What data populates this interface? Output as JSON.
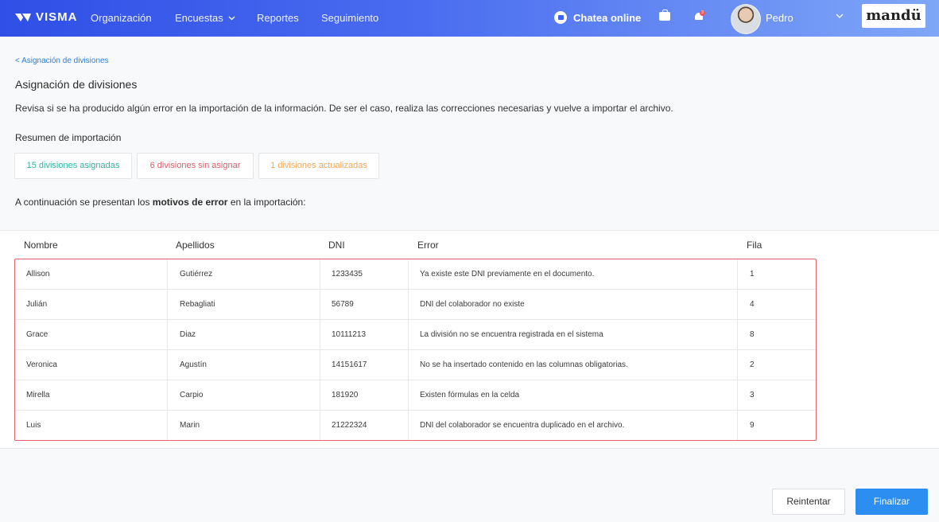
{
  "topbar": {
    "brand": "VISMA",
    "nav": [
      "Organización",
      "Encuestas",
      "Reportes",
      "Seguimiento"
    ],
    "chat_label": "Chatea online",
    "notif_count": "3",
    "user_name": "Pedro",
    "partner_logo": "mandü"
  },
  "page": {
    "breadcrumb": "< Asignación de divisiones",
    "title": "Asignación de divisiones",
    "description": "Revisa si se ha producido algún error en la importación de la información. De ser el caso, realiza las correcciones necesarias y vuelve a importar el archivo.",
    "summary_title": "Resumen de importación",
    "chips": {
      "assigned": "15 divisiones asignadas",
      "unassigned": "6 divisiones sin asignar",
      "updated": "1 divisiones actualizadas"
    },
    "intro_before": "A continuación se presentan los ",
    "intro_bold": "motivos de error",
    "intro_after": " en la importación:"
  },
  "table": {
    "headers": [
      "Nombre",
      "Apellidos",
      "DNI",
      "Error",
      "Fila"
    ],
    "rows": [
      [
        "Allison",
        "Gutiérrez",
        "1233435",
        "Ya existe este DNI previamente en el documento.",
        "1"
      ],
      [
        "Julián",
        "Rebagliati",
        "56789",
        "DNI del colaborador no existe",
        "4"
      ],
      [
        "Grace",
        "Diaz",
        "10111213",
        "La división no se encuentra registrada en el sistema",
        "8"
      ],
      [
        "Veronica",
        "Agustín",
        "14151617",
        "No se ha insertado contenido en las columnas obligatorias.",
        "2"
      ],
      [
        "Mirella",
        "Carpio",
        "181920",
        "Existen fórmulas en la celda",
        "3"
      ],
      [
        "Luis",
        "Marin",
        "21222324",
        "DNI del colaborador se encuentra duplicado en el archivo.",
        "9"
      ]
    ]
  },
  "actions": {
    "retry": "Reintentar",
    "finish": "Finalizar"
  },
  "colors": {
    "accent": "#2b8ef0",
    "success": "#2fb3a5",
    "error": "#e05a66",
    "warning": "#f0a85a"
  }
}
